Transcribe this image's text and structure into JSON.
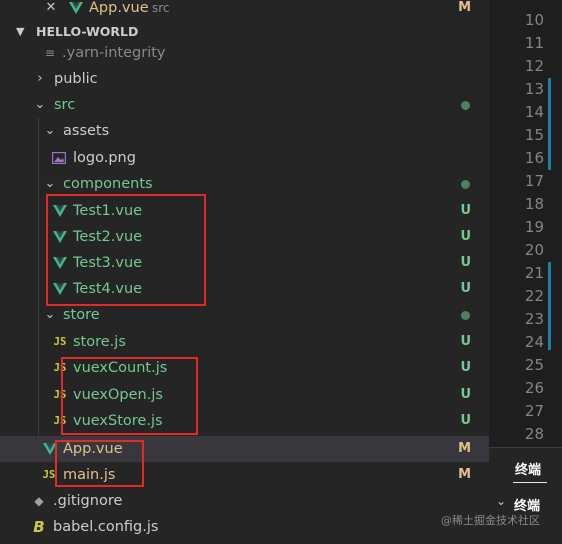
{
  "open_editor": {
    "name": "App.vue",
    "folder": "src",
    "badge": "M"
  },
  "section_title": "HELLO-WORLD",
  "tree": {
    "yarn_integrity": ".yarn-integrity",
    "public": "public",
    "src": "src",
    "assets": "assets",
    "logo": "logo.png",
    "components": "components",
    "test1": "Test1.vue",
    "test2": "Test2.vue",
    "test3": "Test3.vue",
    "test4": "Test4.vue",
    "store": "store",
    "store_js": "store.js",
    "vuex_count": "vuexCount.js",
    "vuex_open": "vuexOpen.js",
    "vuex_store": "vuexStore.js",
    "app_vue": "App.vue",
    "main_js": "main.js",
    "gitignore": ".gitignore",
    "babel": "babel.config.js"
  },
  "badges": {
    "untracked": "U",
    "modified": "M"
  },
  "js_icon_text": "JS",
  "line_numbers": [
    "10",
    "11",
    "12",
    "13",
    "14",
    "15",
    "16",
    "17",
    "18",
    "19",
    "20",
    "21",
    "22",
    "23",
    "24",
    "25",
    "26",
    "27",
    "28"
  ],
  "terminal": {
    "tab": "终端",
    "section": "终端"
  },
  "watermark": "@稀土掘金技术社区",
  "colors": {
    "untracked": "#73c991",
    "modified": "#e2c08d",
    "vue": "#41b883",
    "annotation": "#e32a2a"
  }
}
